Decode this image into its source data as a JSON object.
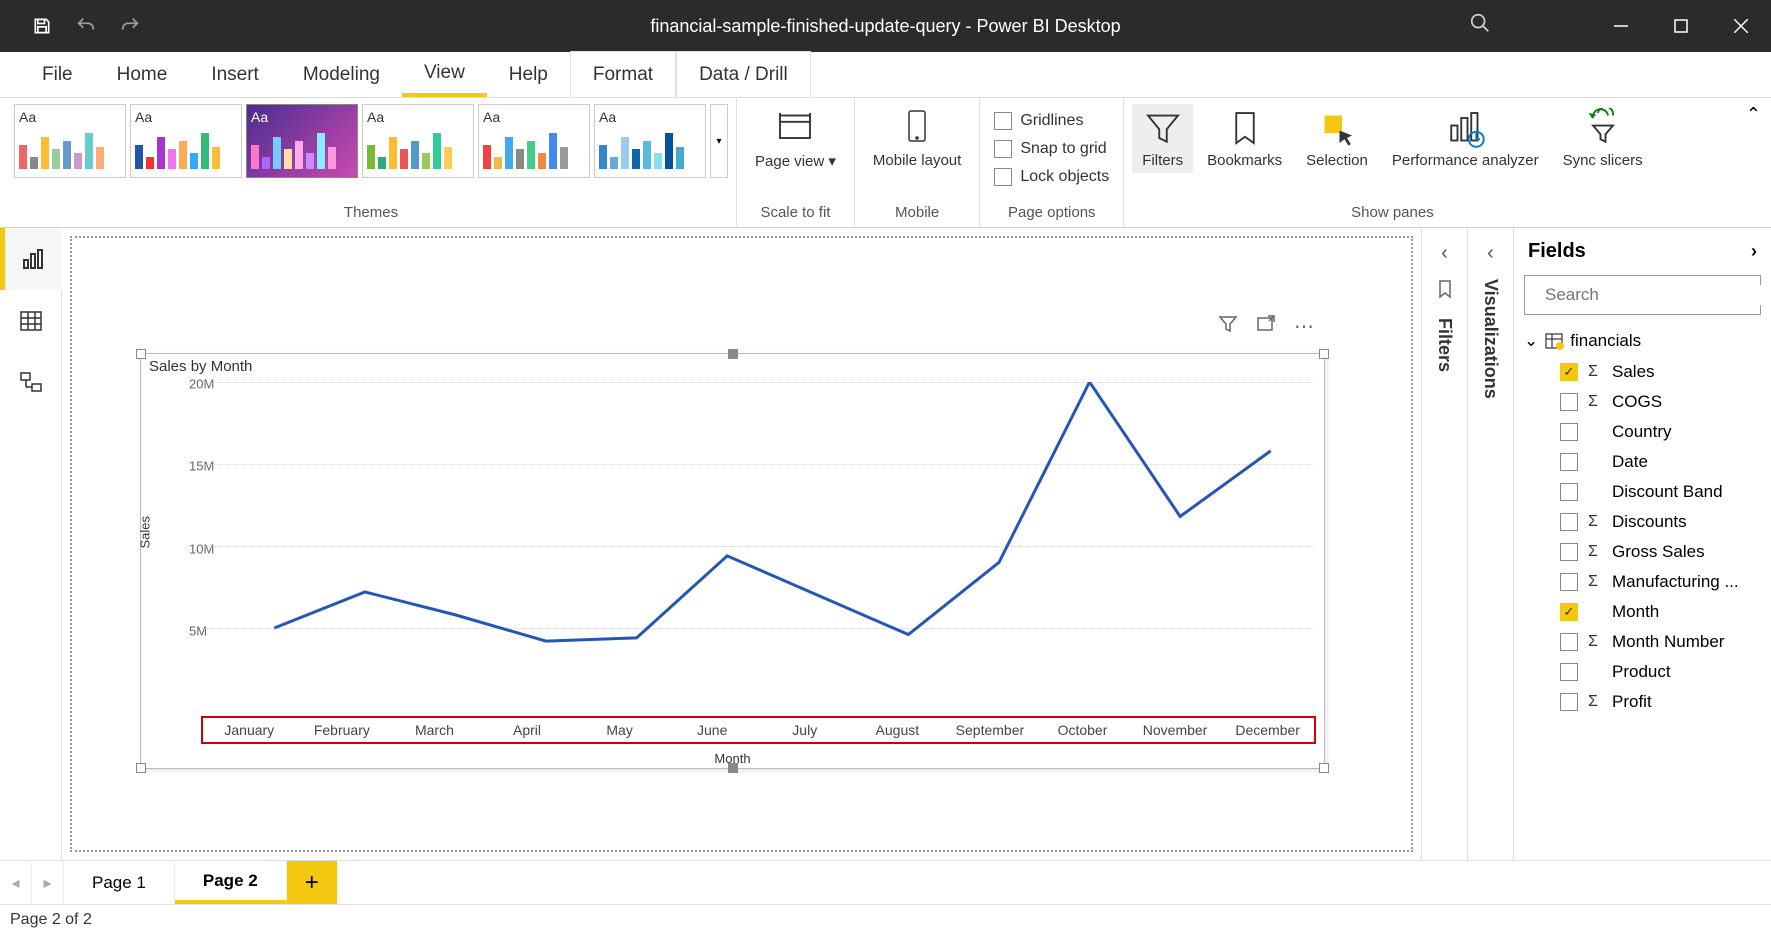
{
  "titlebar": {
    "title": "financial-sample-finished-update-query - Power BI Desktop"
  },
  "menubar": {
    "items": [
      "File",
      "Home",
      "Insert",
      "Modeling",
      "View",
      "Help",
      "Format",
      "Data / Drill"
    ],
    "active": "View"
  },
  "ribbon": {
    "themes_label": "Themes",
    "scale_label": "Scale to fit",
    "mobile_label": "Mobile",
    "pageopts_label": "Page options",
    "showpanes_label": "Show panes",
    "page_view": "Page view",
    "mobile_layout": "Mobile layout",
    "gridlines": "Gridlines",
    "snap": "Snap to grid",
    "lock": "Lock objects",
    "filters": "Filters",
    "bookmarks": "Bookmarks",
    "selection": "Selection",
    "perf": "Performance analyzer",
    "sync": "Sync slicers"
  },
  "pane_filters": "Filters",
  "pane_viz": "Visualizations",
  "fields": {
    "title": "Fields",
    "search_placeholder": "Search",
    "table": "financials",
    "items": [
      {
        "label": "Sales",
        "checked": true,
        "sigma": true
      },
      {
        "label": "COGS",
        "checked": false,
        "sigma": true
      },
      {
        "label": "Country",
        "checked": false,
        "sigma": false
      },
      {
        "label": "Date",
        "checked": false,
        "sigma": false
      },
      {
        "label": "Discount Band",
        "checked": false,
        "sigma": false
      },
      {
        "label": "Discounts",
        "checked": false,
        "sigma": true
      },
      {
        "label": "Gross Sales",
        "checked": false,
        "sigma": true
      },
      {
        "label": "Manufacturing ...",
        "checked": false,
        "sigma": true
      },
      {
        "label": "Month",
        "checked": true,
        "sigma": false
      },
      {
        "label": "Month Number",
        "checked": false,
        "sigma": true
      },
      {
        "label": "Product",
        "checked": false,
        "sigma": false
      },
      {
        "label": "Profit",
        "checked": false,
        "sigma": true
      }
    ]
  },
  "pages": {
    "items": [
      "Page 1",
      "Page 2"
    ],
    "active": 1
  },
  "status": "Page 2 of 2",
  "chart_data": {
    "type": "line",
    "title": "Sales by Month",
    "xlabel": "Month",
    "ylabel": "Sales",
    "ylim": [
      0,
      20000000
    ],
    "y_ticks": [
      "5M",
      "10M",
      "15M",
      "20M"
    ],
    "categories": [
      "January",
      "February",
      "March",
      "April",
      "May",
      "June",
      "July",
      "August",
      "September",
      "October",
      "November",
      "December"
    ],
    "values": [
      5000000,
      7200000,
      5800000,
      4200000,
      4400000,
      9400000,
      7000000,
      4600000,
      9000000,
      20000000,
      11800000,
      15800000
    ]
  }
}
